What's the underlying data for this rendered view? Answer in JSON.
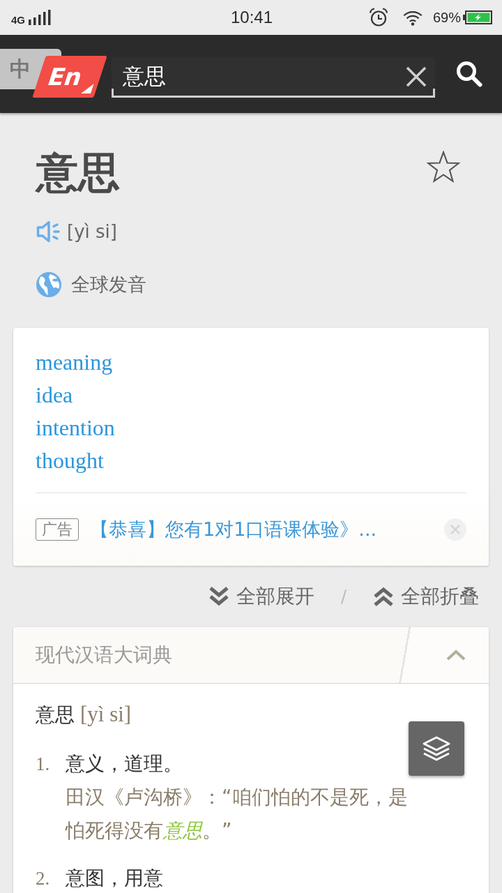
{
  "status_bar": {
    "network": "4G",
    "time": "10:41",
    "battery": "69%"
  },
  "header": {
    "languages": [
      {
        "label": "中",
        "selected": false
      },
      {
        "label": "En",
        "selected": true
      }
    ],
    "search": {
      "value": "意思"
    }
  },
  "entry": {
    "word": "意思",
    "starred": false,
    "pinyin": "[yì si]",
    "global_pronunciation": "全球发音"
  },
  "translations": {
    "meanings": [
      "meaning",
      "idea",
      "intention",
      "thought"
    ],
    "ad": {
      "tag": "广告",
      "text": "【恭喜】您有1对1口语课体验》..."
    }
  },
  "fold_controls": {
    "expand_all": "全部展开",
    "separator": "/",
    "collapse_all": "全部折叠"
  },
  "dictionary": {
    "title": "现代汉语大词典",
    "expanded": true,
    "headword": "意思",
    "pinyin": "[yì si]",
    "senses": [
      {
        "number": "1.",
        "definition": "意义，道理。",
        "example": [
          {
            "text": "田汉《卢沟桥》：“咱们怕的不是死，是怕死得没有",
            "highlight": false
          },
          {
            "text": "意思",
            "highlight": true
          },
          {
            "text": "。”",
            "highlight": false
          }
        ]
      },
      {
        "number": "2.",
        "definition": "意图，用意"
      }
    ]
  }
}
